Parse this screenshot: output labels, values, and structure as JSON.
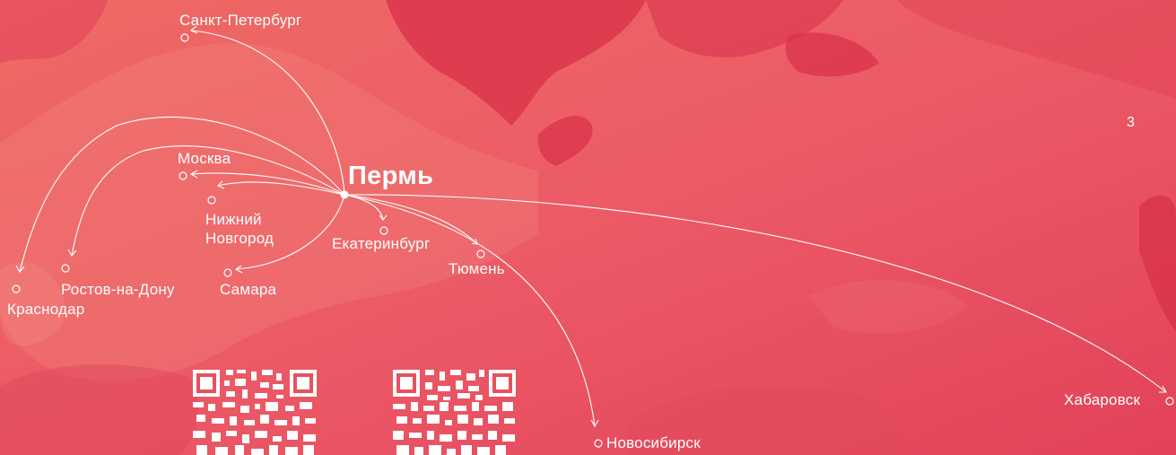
{
  "map": {
    "hub": "Пермь",
    "page_number": "3",
    "destinations": {
      "spb": "Санкт-Петербург",
      "moscow": "Москва",
      "nizhny_line1": "Нижний",
      "nizhny_line2": "Новгород",
      "rostov": "Ростов-на-Дону",
      "krasnodar": "Краснодар",
      "samara": "Самара",
      "yekaterinburg": "Екатеринбург",
      "tyumen": "Тюмень",
      "novosibirsk": "Новосибирск",
      "khabarovsk": "Хабаровск"
    },
    "colors": {
      "background": "#e8505f",
      "land_dark": "#d93048",
      "route_line": "#ffffff",
      "qr_dark": "#ffffff"
    }
  }
}
